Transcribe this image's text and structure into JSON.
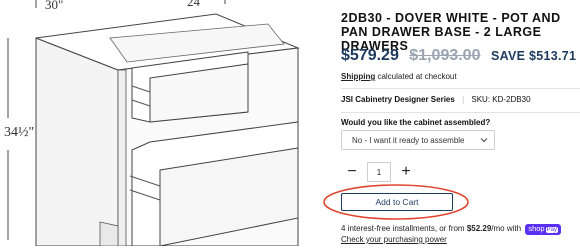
{
  "image": {
    "dimensions": {
      "width": "30\"",
      "depth": "24",
      "height": "34½\""
    }
  },
  "product": {
    "title": "2DB30 - DOVER WHITE - POT AND PAN DRAWER BASE - 2 LARGE DRAWERS",
    "price_current": "$579.29",
    "price_compare": "$1,093.00",
    "price_save": "SAVE $513.71",
    "shipping_link": "Shipping",
    "shipping_text": " calculated at checkout",
    "vendor": "JSI Cabinetry Designer Series",
    "sku_label": "SKU:",
    "sku_value": "KD-2DB30"
  },
  "options": {
    "assemble_label": "Would you like the cabinet assembled?",
    "assemble_selected": "No - I want it ready to assemble"
  },
  "quantity": {
    "minus": "−",
    "value": "1",
    "plus": "+"
  },
  "cart": {
    "add_to_cart": "Add to Cart"
  },
  "installments": {
    "prefix": "4 interest-free installments, or from ",
    "amount": "$52.29",
    "suffix": "/mo with ",
    "shop_label": "shop",
    "pay_label": "Pay",
    "check_power": "Check your purchasing power"
  },
  "colors": {
    "accent": "#1e3a5f",
    "annotation_circle": "#e0452f",
    "shop_pay": "#5a31f4"
  }
}
